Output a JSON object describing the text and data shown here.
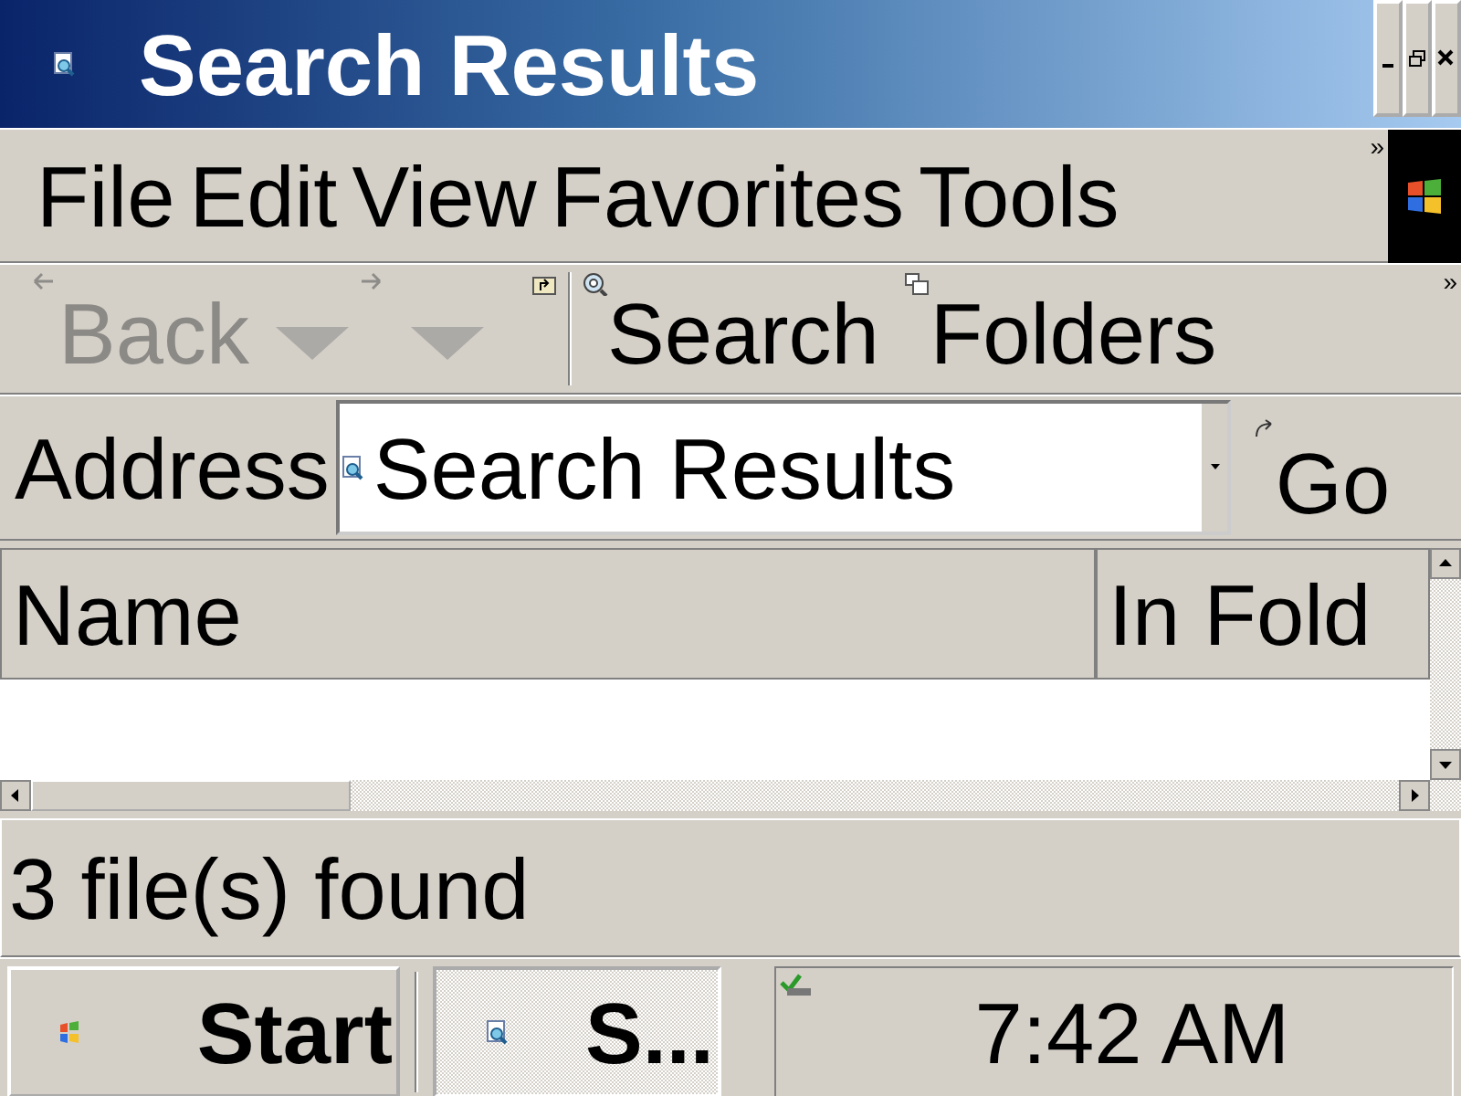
{
  "window": {
    "title": "Search Results"
  },
  "menu": {
    "items": [
      "File",
      "Edit",
      "View",
      "Favorites",
      "Tools"
    ],
    "overflow": "»"
  },
  "toolbar": {
    "buttons": [
      {
        "kind": "back",
        "label": "Back",
        "disabled": true
      },
      {
        "kind": "forward",
        "disabled": true
      },
      {
        "kind": "up",
        "disabled": false
      },
      {
        "kind": "search",
        "label": "Search",
        "disabled": false
      },
      {
        "kind": "folders",
        "label": "Folders",
        "disabled": false
      }
    ],
    "overflow": "»"
  },
  "address_bar": {
    "label": "Address",
    "value": "Search Results",
    "go": "Go"
  },
  "list": {
    "columns": [
      "Name",
      "In Fold"
    ]
  },
  "status_bar": {
    "text": "3 file(s) found"
  },
  "taskbar": {
    "start": "Start",
    "tasks": [
      {
        "label": "S...",
        "selected": true
      }
    ],
    "clock": "7:42 AM"
  }
}
